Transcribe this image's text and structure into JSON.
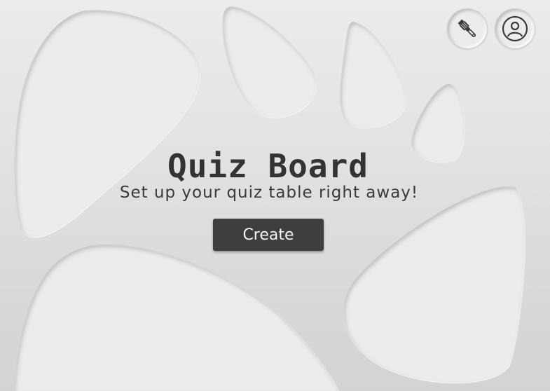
{
  "hero": {
    "title": "Quiz Board",
    "subtitle": "Set up your quiz table right away!",
    "create_label": "Create"
  },
  "toolbar": {
    "theme_button_icon": "paint-brush-icon",
    "account_button_icon": "user-account-icon"
  },
  "colors": {
    "background": "#e4e4e4",
    "blob": "#ebebeb",
    "button": "#3e3e3e",
    "text": "#333333"
  }
}
